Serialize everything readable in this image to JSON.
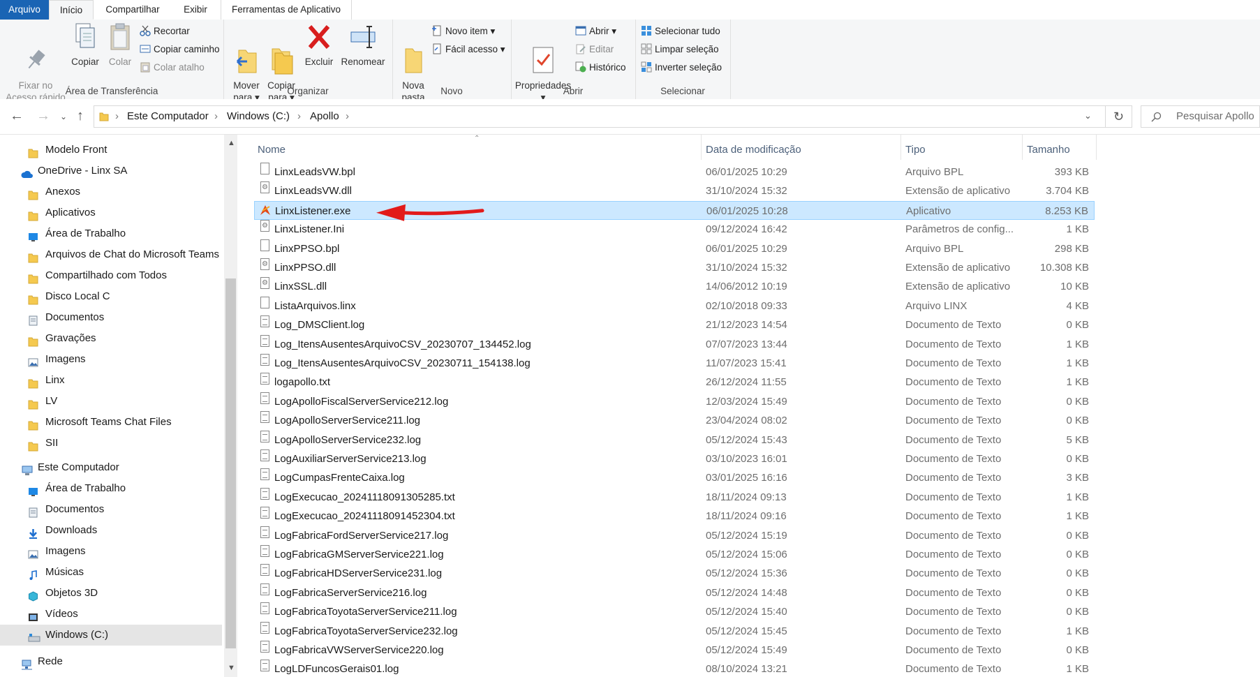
{
  "tabs": [
    "Arquivo",
    "Início",
    "Compartilhar",
    "Exibir",
    "Ferramentas de Aplicativo"
  ],
  "ribbon": {
    "clipboard": {
      "label": "Área de Transferência",
      "pin": "Fixar no\nAcesso rápido",
      "copy": "Copiar",
      "paste": "Colar",
      "cut": "Recortar",
      "copy_path": "Copiar caminho",
      "paste_shortcut": "Colar atalho"
    },
    "organize": {
      "label": "Organizar",
      "move": "Mover\npara ▾",
      "copyto": "Copiar\npara ▾",
      "delete": "Excluir",
      "rename": "Renomear"
    },
    "new": {
      "label": "Novo",
      "folder": "Nova\npasta",
      "new_item": "Novo item ▾",
      "easy_access": "Fácil acesso ▾"
    },
    "open": {
      "label": "Abrir",
      "properties": "Propriedades\n▾",
      "open": "Abrir ▾",
      "edit": "Editar",
      "history": "Histórico"
    },
    "select": {
      "label": "Selecionar",
      "all": "Selecionar tudo",
      "none": "Limpar seleção",
      "invert": "Inverter seleção"
    }
  },
  "address": {
    "crumbs": [
      "Este Computador",
      "Windows (C:)",
      "Apollo"
    ],
    "search_placeholder": "Pesquisar Apollo"
  },
  "sidebar": [
    {
      "label": "Modelo Front",
      "icon": "folder-icon",
      "level": 2
    },
    {
      "label": "OneDrive - Linx SA",
      "icon": "cloud-icon",
      "level": 1
    },
    {
      "label": "Anexos",
      "icon": "folder-icon",
      "level": 2
    },
    {
      "label": "Aplicativos",
      "icon": "folder-icon",
      "level": 2
    },
    {
      "label": "Área de Trabalho",
      "icon": "desktop-icon",
      "level": 2
    },
    {
      "label": "Arquivos de Chat do Microsoft Teams",
      "icon": "folder-icon",
      "level": 2
    },
    {
      "label": "Compartilhado com Todos",
      "icon": "folder-icon",
      "level": 2
    },
    {
      "label": "Disco Local C",
      "icon": "folder-icon",
      "level": 2
    },
    {
      "label": "Documentos",
      "icon": "documents-icon",
      "level": 2
    },
    {
      "label": "Gravações",
      "icon": "folder-icon",
      "level": 2
    },
    {
      "label": "Imagens",
      "icon": "pictures-icon",
      "level": 2
    },
    {
      "label": "Linx",
      "icon": "folder-icon",
      "level": 2
    },
    {
      "label": "LV",
      "icon": "folder-icon",
      "level": 2
    },
    {
      "label": "Microsoft Teams Chat Files",
      "icon": "folder-icon",
      "level": 2
    },
    {
      "label": "SII",
      "icon": "folder-icon",
      "level": 2
    },
    {
      "label": "Este Computador",
      "icon": "computer-icon",
      "level": 1
    },
    {
      "label": "Área de Trabalho",
      "icon": "desktop-icon",
      "level": 2
    },
    {
      "label": "Documentos",
      "icon": "documents-icon",
      "level": 2
    },
    {
      "label": "Downloads",
      "icon": "downloads-icon",
      "level": 2
    },
    {
      "label": "Imagens",
      "icon": "pictures-icon",
      "level": 2
    },
    {
      "label": "Músicas",
      "icon": "music-icon",
      "level": 2
    },
    {
      "label": "Objetos 3D",
      "icon": "objects3d-icon",
      "level": 2
    },
    {
      "label": "Vídeos",
      "icon": "videos-icon",
      "level": 2
    },
    {
      "label": "Windows (C:)",
      "icon": "drive-icon",
      "level": 2,
      "selected": true
    },
    {
      "label": "Rede",
      "icon": "network-icon",
      "level": 1
    }
  ],
  "columns": {
    "name": "Nome",
    "date": "Data de modificação",
    "type": "Tipo",
    "size": "Tamanho"
  },
  "files": [
    {
      "name": "LinxLeadsVW.bpl",
      "date": "06/01/2025 10:29",
      "type": "Arquivo BPL",
      "size": "393 KB",
      "icon": "file"
    },
    {
      "name": "LinxLeadsVW.dll",
      "date": "31/10/2024 15:32",
      "type": "Extensão de aplicativo",
      "size": "3.704 KB",
      "icon": "dll"
    },
    {
      "name": "LinxListener.exe",
      "date": "06/01/2025 10:28",
      "type": "Aplicativo",
      "size": "8.253 KB",
      "icon": "exe",
      "selected": true
    },
    {
      "name": "LinxListener.Ini",
      "date": "09/12/2024 16:42",
      "type": "Parâmetros de config...",
      "size": "1 KB",
      "icon": "dll"
    },
    {
      "name": "LinxPPSO.bpl",
      "date": "06/01/2025 10:29",
      "type": "Arquivo BPL",
      "size": "298 KB",
      "icon": "file"
    },
    {
      "name": "LinxPPSO.dll",
      "date": "31/10/2024 15:32",
      "type": "Extensão de aplicativo",
      "size": "10.308 KB",
      "icon": "dll"
    },
    {
      "name": "LinxSSL.dll",
      "date": "14/06/2012 10:19",
      "type": "Extensão de aplicativo",
      "size": "10 KB",
      "icon": "dll"
    },
    {
      "name": "ListaArquivos.linx",
      "date": "02/10/2018 09:33",
      "type": "Arquivo LINX",
      "size": "4 KB",
      "icon": "file"
    },
    {
      "name": "Log_DMSClient.log",
      "date": "21/12/2023 14:54",
      "type": "Documento de Texto",
      "size": "0 KB",
      "icon": "txt"
    },
    {
      "name": "Log_ItensAusentesArquivoCSV_20230707_134452.log",
      "date": "07/07/2023 13:44",
      "type": "Documento de Texto",
      "size": "1 KB",
      "icon": "txt"
    },
    {
      "name": "Log_ItensAusentesArquivoCSV_20230711_154138.log",
      "date": "11/07/2023 15:41",
      "type": "Documento de Texto",
      "size": "1 KB",
      "icon": "txt"
    },
    {
      "name": "logapollo.txt",
      "date": "26/12/2024 11:55",
      "type": "Documento de Texto",
      "size": "1 KB",
      "icon": "txt"
    },
    {
      "name": "LogApolloFiscalServerService212.log",
      "date": "12/03/2024 15:49",
      "type": "Documento de Texto",
      "size": "0 KB",
      "icon": "txt"
    },
    {
      "name": "LogApolloServerService211.log",
      "date": "23/04/2024 08:02",
      "type": "Documento de Texto",
      "size": "0 KB",
      "icon": "txt"
    },
    {
      "name": "LogApolloServerService232.log",
      "date": "05/12/2024 15:43",
      "type": "Documento de Texto",
      "size": "5 KB",
      "icon": "txt"
    },
    {
      "name": "LogAuxiliarServerService213.log",
      "date": "03/10/2023 16:01",
      "type": "Documento de Texto",
      "size": "0 KB",
      "icon": "txt"
    },
    {
      "name": "LogCumpasFrenteCaixa.log",
      "date": "03/01/2025 16:16",
      "type": "Documento de Texto",
      "size": "3 KB",
      "icon": "txt"
    },
    {
      "name": "LogExecucao_20241118091305285.txt",
      "date": "18/11/2024 09:13",
      "type": "Documento de Texto",
      "size": "1 KB",
      "icon": "txt"
    },
    {
      "name": "LogExecucao_20241118091452304.txt",
      "date": "18/11/2024 09:16",
      "type": "Documento de Texto",
      "size": "1 KB",
      "icon": "txt"
    },
    {
      "name": "LogFabricaFordServerService217.log",
      "date": "05/12/2024 15:19",
      "type": "Documento de Texto",
      "size": "0 KB",
      "icon": "txt"
    },
    {
      "name": "LogFabricaGMServerService221.log",
      "date": "05/12/2024 15:06",
      "type": "Documento de Texto",
      "size": "0 KB",
      "icon": "txt"
    },
    {
      "name": "LogFabricaHDServerService231.log",
      "date": "05/12/2024 15:36",
      "type": "Documento de Texto",
      "size": "0 KB",
      "icon": "txt"
    },
    {
      "name": "LogFabricaServerService216.log",
      "date": "05/12/2024 14:48",
      "type": "Documento de Texto",
      "size": "0 KB",
      "icon": "txt"
    },
    {
      "name": "LogFabricaToyotaServerService211.log",
      "date": "05/12/2024 15:40",
      "type": "Documento de Texto",
      "size": "0 KB",
      "icon": "txt"
    },
    {
      "name": "LogFabricaToyotaServerService232.log",
      "date": "05/12/2024 15:45",
      "type": "Documento de Texto",
      "size": "1 KB",
      "icon": "txt"
    },
    {
      "name": "LogFabricaVWServerService220.log",
      "date": "05/12/2024 15:49",
      "type": "Documento de Texto",
      "size": "0 KB",
      "icon": "txt"
    },
    {
      "name": "LogLDFuncosGerais01.log",
      "date": "08/10/2024 13:21",
      "type": "Documento de Texto",
      "size": "1 KB",
      "icon": "txt"
    }
  ],
  "colors": {
    "accent": "#1a64b4",
    "selection": "#cce8ff",
    "arrow": "#e21a1a"
  }
}
